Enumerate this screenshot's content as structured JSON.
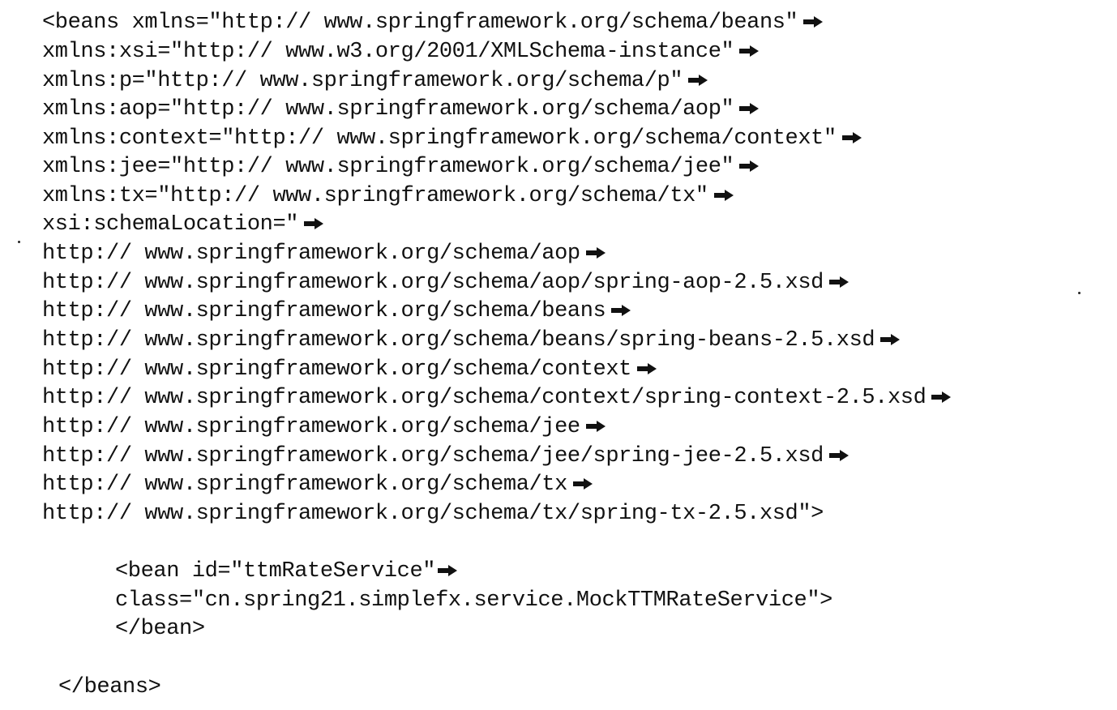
{
  "document": {
    "lines": [
      {
        "text": "<beans xmlns=\"http:// www.springframework.org/schema/beans\"",
        "continuation": true
      },
      {
        "text": "xmlns:xsi=\"http:// www.w3.org/2001/XMLSchema-instance\"",
        "continuation": true
      },
      {
        "text": "xmlns:p=\"http:// www.springframework.org/schema/p\"",
        "continuation": true
      },
      {
        "text": "xmlns:aop=\"http:// www.springframework.org/schema/aop\"",
        "continuation": true
      },
      {
        "text": "xmlns:context=\"http:// www.springframework.org/schema/context\"",
        "continuation": true
      },
      {
        "text": "xmlns:jee=\"http:// www.springframework.org/schema/jee\"",
        "continuation": true
      },
      {
        "text": "xmlns:tx=\"http:// www.springframework.org/schema/tx\"",
        "continuation": true
      },
      {
        "text": "xsi:schemaLocation=\"",
        "continuation": true
      },
      {
        "text": "http:// www.springframework.org/schema/aop",
        "continuation": true
      },
      {
        "text": "http:// www.springframework.org/schema/aop/spring-aop-2.5.xsd",
        "continuation": true
      },
      {
        "text": "http:// www.springframework.org/schema/beans",
        "continuation": true
      },
      {
        "text": "http:// www.springframework.org/schema/beans/spring-beans-2.5.xsd",
        "continuation": true
      },
      {
        "text": "http:// www.springframework.org/schema/context",
        "continuation": true
      },
      {
        "text": "http:// www.springframework.org/schema/context/spring-context-2.5.xsd",
        "continuation": true
      },
      {
        "text": "http:// www.springframework.org/schema/jee",
        "continuation": true
      },
      {
        "text": "http:// www.springframework.org/schema/jee/spring-jee-2.5.xsd",
        "continuation": true
      },
      {
        "text": "http:// www.springframework.org/schema/tx",
        "continuation": true
      },
      {
        "text": "http:// www.springframework.org/schema/tx/spring-tx-2.5.xsd\">",
        "continuation": false
      },
      {
        "text": "<bean id=\"ttmRateService\"",
        "continuation": true
      },
      {
        "text": "class=\"cn.spring21.simplefx.service.MockTTMRateService\">",
        "continuation": false
      },
      {
        "text": "</bean>",
        "continuation": false
      },
      {
        "text": "</beans>",
        "continuation": false
      }
    ],
    "continuation_icon": "line-continuation-arrow-icon",
    "text_color": "#111111"
  }
}
